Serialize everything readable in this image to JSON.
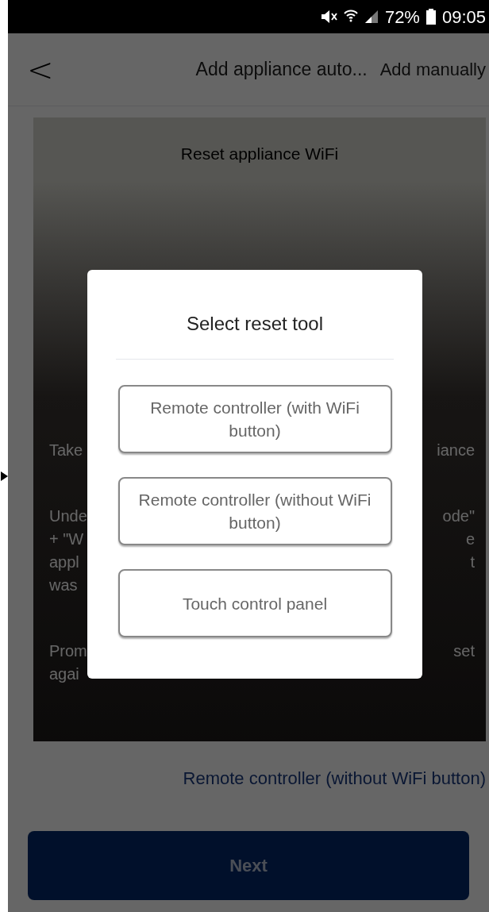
{
  "status_bar": {
    "battery": "72%",
    "time": "09:05"
  },
  "header": {
    "back": "<",
    "title": "Add appliance auto...",
    "action": "Add manually"
  },
  "panel": {
    "title": "Reset appliance WiFi",
    "paragraphs": [
      {
        "lines": [
          {
            "left": "Take",
            "right": "iance"
          }
        ]
      },
      {
        "lines": [
          {
            "left": "Unde",
            "right": "ode\""
          },
          {
            "left": "+ \"W",
            "right": "e"
          },
          {
            "left": "appl",
            "right": "t"
          },
          {
            "left": "was"
          }
        ]
      },
      {
        "lines": [
          {
            "left": "Prom",
            "right": "set"
          },
          {
            "left": "agai"
          }
        ]
      }
    ]
  },
  "selected_tool": "Remote controller (without WiFi button)",
  "next_button": "Next",
  "dialog": {
    "title": "Select reset tool",
    "options": [
      {
        "label": "Remote controller (with WiFi button)"
      },
      {
        "label": "Remote controller (without WiFi button)"
      },
      {
        "label": "Touch control panel"
      }
    ]
  }
}
